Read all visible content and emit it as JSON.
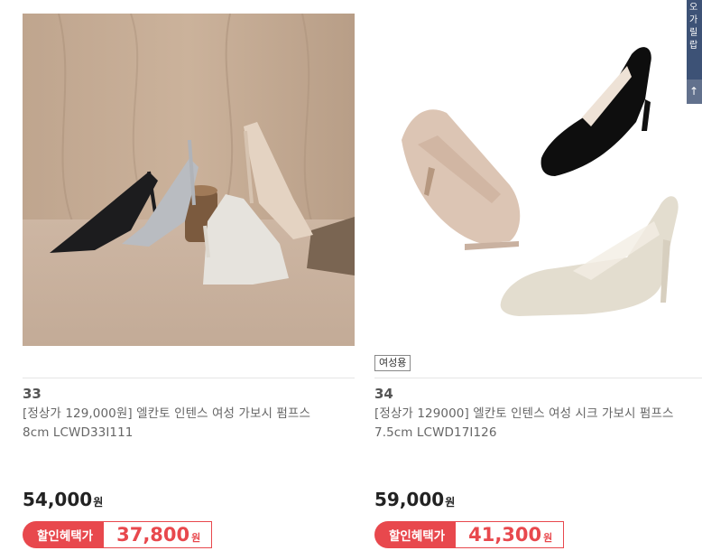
{
  "products": [
    {
      "number": "33",
      "name": "[정상가 129,000원] 엘칸토 인텐스 여성 가보시 펌프스 8cm LCWD33I111",
      "price": "54,000",
      "price_unit": "원",
      "benefit_label": "할인혜택가",
      "benefit_price": "37,800",
      "benefit_unit": "원",
      "tag": ""
    },
    {
      "number": "34",
      "name": "[정상가 129000] 엘칸토 인텐스 여성 시크 가보시 펌프스 7.5cm LCWD17I126",
      "price": "59,000",
      "price_unit": "원",
      "benefit_label": "할인혜택가",
      "benefit_price": "41,300",
      "benefit_unit": "원",
      "tag": "여성용"
    }
  ],
  "side_panel": {
    "text": "오\n가\n릴\n랍",
    "bottom": "↑"
  },
  "colors": {
    "accent": "#e8484d",
    "side_panel": "#3d5276"
  }
}
